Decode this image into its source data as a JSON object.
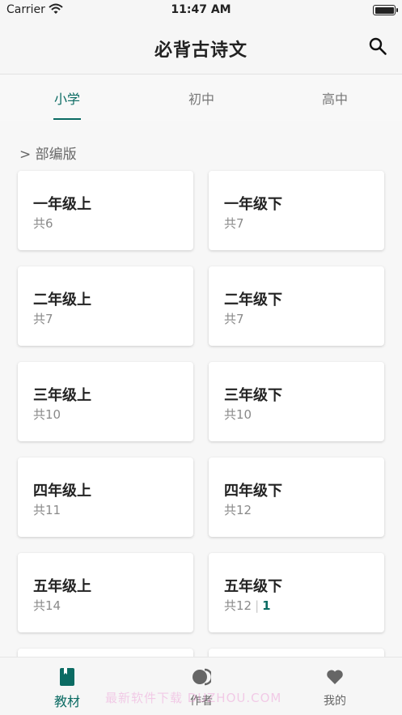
{
  "status_bar": {
    "carrier": "Carrier",
    "time": "11:47 AM"
  },
  "navbar": {
    "title": "必背古诗文",
    "search_icon": "search-icon"
  },
  "tabs": [
    {
      "label": "小学",
      "active": true
    },
    {
      "label": "初中",
      "active": false
    },
    {
      "label": "高中",
      "active": false
    }
  ],
  "section_label": "> 部编版",
  "cards": [
    {
      "name": "一年级上",
      "count": "共6",
      "progress": ""
    },
    {
      "name": "一年级下",
      "count": "共7",
      "progress": ""
    },
    {
      "name": "二年级上",
      "count": "共7",
      "progress": ""
    },
    {
      "name": "二年级下",
      "count": "共7",
      "progress": ""
    },
    {
      "name": "三年级上",
      "count": "共10",
      "progress": ""
    },
    {
      "name": "三年级下",
      "count": "共10",
      "progress": ""
    },
    {
      "name": "四年级上",
      "count": "共11",
      "progress": ""
    },
    {
      "name": "四年级下",
      "count": "共12",
      "progress": ""
    },
    {
      "name": "五年级上",
      "count": "共14",
      "progress": ""
    },
    {
      "name": "五年级下",
      "count": "共12",
      "separator": "|",
      "progress": "1"
    }
  ],
  "tabbar": [
    {
      "label": "教材",
      "icon": "book-icon",
      "active": true
    },
    {
      "label": "作者",
      "icon": "author-icon",
      "active": false
    },
    {
      "label": "我的",
      "icon": "heart-icon",
      "active": false
    }
  ],
  "watermark": "最新软件下载 DUZHOU.COM",
  "colors": {
    "accent": "#0b6b63",
    "background": "#f7f7f7",
    "card": "#ffffff"
  }
}
